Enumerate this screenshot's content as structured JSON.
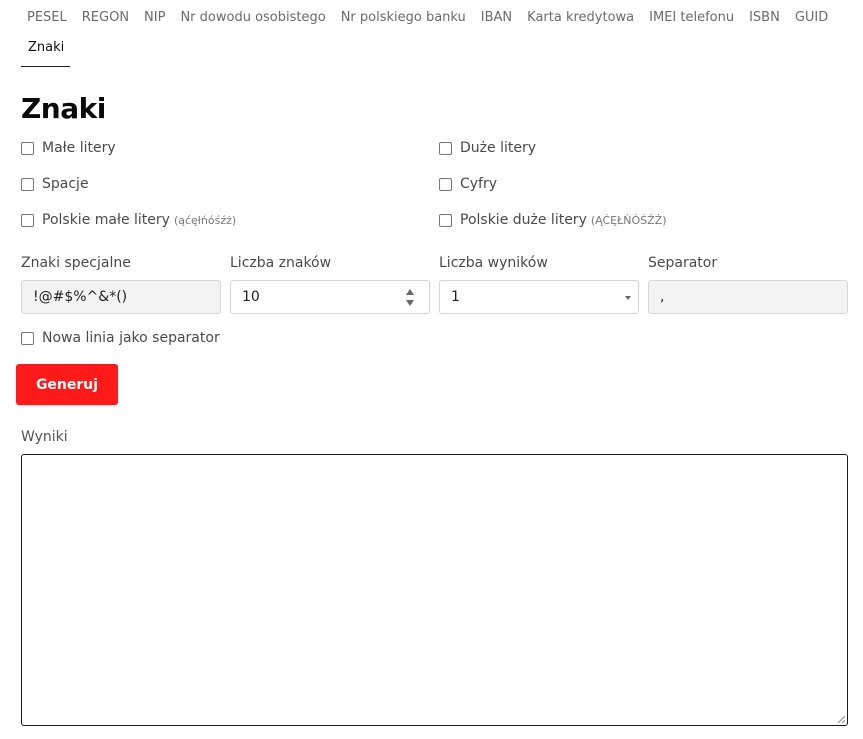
{
  "nav": {
    "tabs": [
      "PESEL",
      "REGON",
      "NIP",
      "Nr dowodu osobistego",
      "Nr polskiego banku",
      "IBAN",
      "Karta kredytowa",
      "IMEI telefonu",
      "ISBN",
      "GUID"
    ],
    "active_tab": "Znaki"
  },
  "page": {
    "title": "Znaki"
  },
  "options": {
    "lowercase": "Małe litery",
    "uppercase": "Duże litery",
    "spaces": "Spacje",
    "digits": "Cyfry",
    "polish_lowercase": "Polskie małe litery",
    "polish_lowercase_hint": "(ąćęłńóśźż)",
    "polish_uppercase": "Polskie duże litery",
    "polish_uppercase_hint": "(ĄĆĘŁŃÓŚŹŻ)",
    "newline_separator": "Nowa linia jako separator"
  },
  "fields": {
    "special_label": "Znaki specjalne",
    "special_value": "!@#$%^&*()",
    "count_label": "Liczba znaków",
    "count_value": "10",
    "results_count_label": "Liczba wyników",
    "results_count_value": "1",
    "separator_label": "Separator",
    "separator_value": ","
  },
  "actions": {
    "generate": "Generuj"
  },
  "results": {
    "label": "Wyniki",
    "value": ""
  },
  "colors": {
    "accent": "#ff1a1a"
  }
}
